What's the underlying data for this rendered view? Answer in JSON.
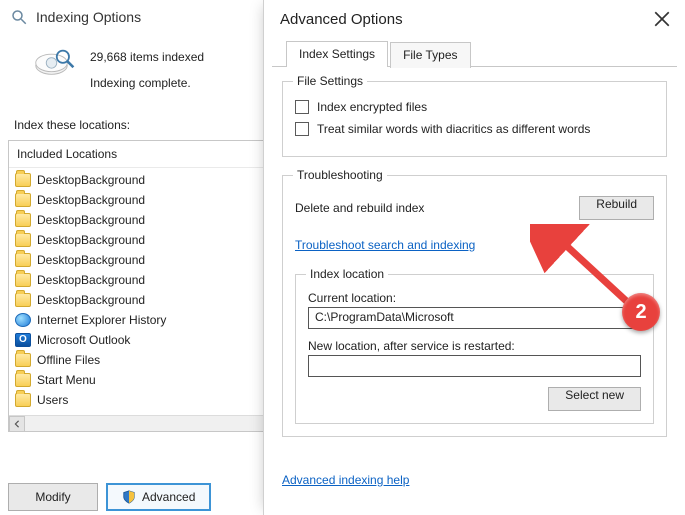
{
  "indexing": {
    "title": "Indexing Options",
    "items_indexed": "29,668 items indexed",
    "status": "Indexing complete.",
    "index_these_label": "Index these locations:",
    "included_header": "Included Locations",
    "locations": [
      {
        "label": "DesktopBackground",
        "icon": "folder"
      },
      {
        "label": "DesktopBackground",
        "icon": "folder"
      },
      {
        "label": "DesktopBackground",
        "icon": "folder"
      },
      {
        "label": "DesktopBackground",
        "icon": "folder"
      },
      {
        "label": "DesktopBackground",
        "icon": "folder"
      },
      {
        "label": "DesktopBackground",
        "icon": "folder"
      },
      {
        "label": "DesktopBackground",
        "icon": "folder"
      },
      {
        "label": "Internet Explorer History",
        "icon": "globe"
      },
      {
        "label": "Microsoft Outlook",
        "icon": "outlook"
      },
      {
        "label": "Offline Files",
        "icon": "folder"
      },
      {
        "label": "Start Menu",
        "icon": "folder"
      },
      {
        "label": "Users",
        "icon": "folder"
      }
    ],
    "buttons": {
      "modify": "Modify",
      "advanced": "Advanced"
    }
  },
  "advanced": {
    "title": "Advanced Options",
    "tabs": {
      "index_settings": "Index Settings",
      "file_types": "File Types"
    },
    "file_settings": {
      "legend": "File Settings",
      "encrypt": "Index encrypted files",
      "diacritics": "Treat similar words with diacritics as different words"
    },
    "troubleshooting": {
      "legend": "Troubleshooting",
      "delete_rebuild": "Delete and rebuild index",
      "rebuild_btn": "Rebuild",
      "link": "Troubleshoot search and indexing"
    },
    "index_location": {
      "legend": "Index location",
      "current_label": "Current location:",
      "current_value": "C:\\ProgramData\\Microsoft",
      "new_label": "New location, after service is restarted:",
      "new_value": "",
      "select_new": "Select new"
    },
    "help_link": "Advanced indexing help"
  },
  "annotation": {
    "badge": "2"
  }
}
